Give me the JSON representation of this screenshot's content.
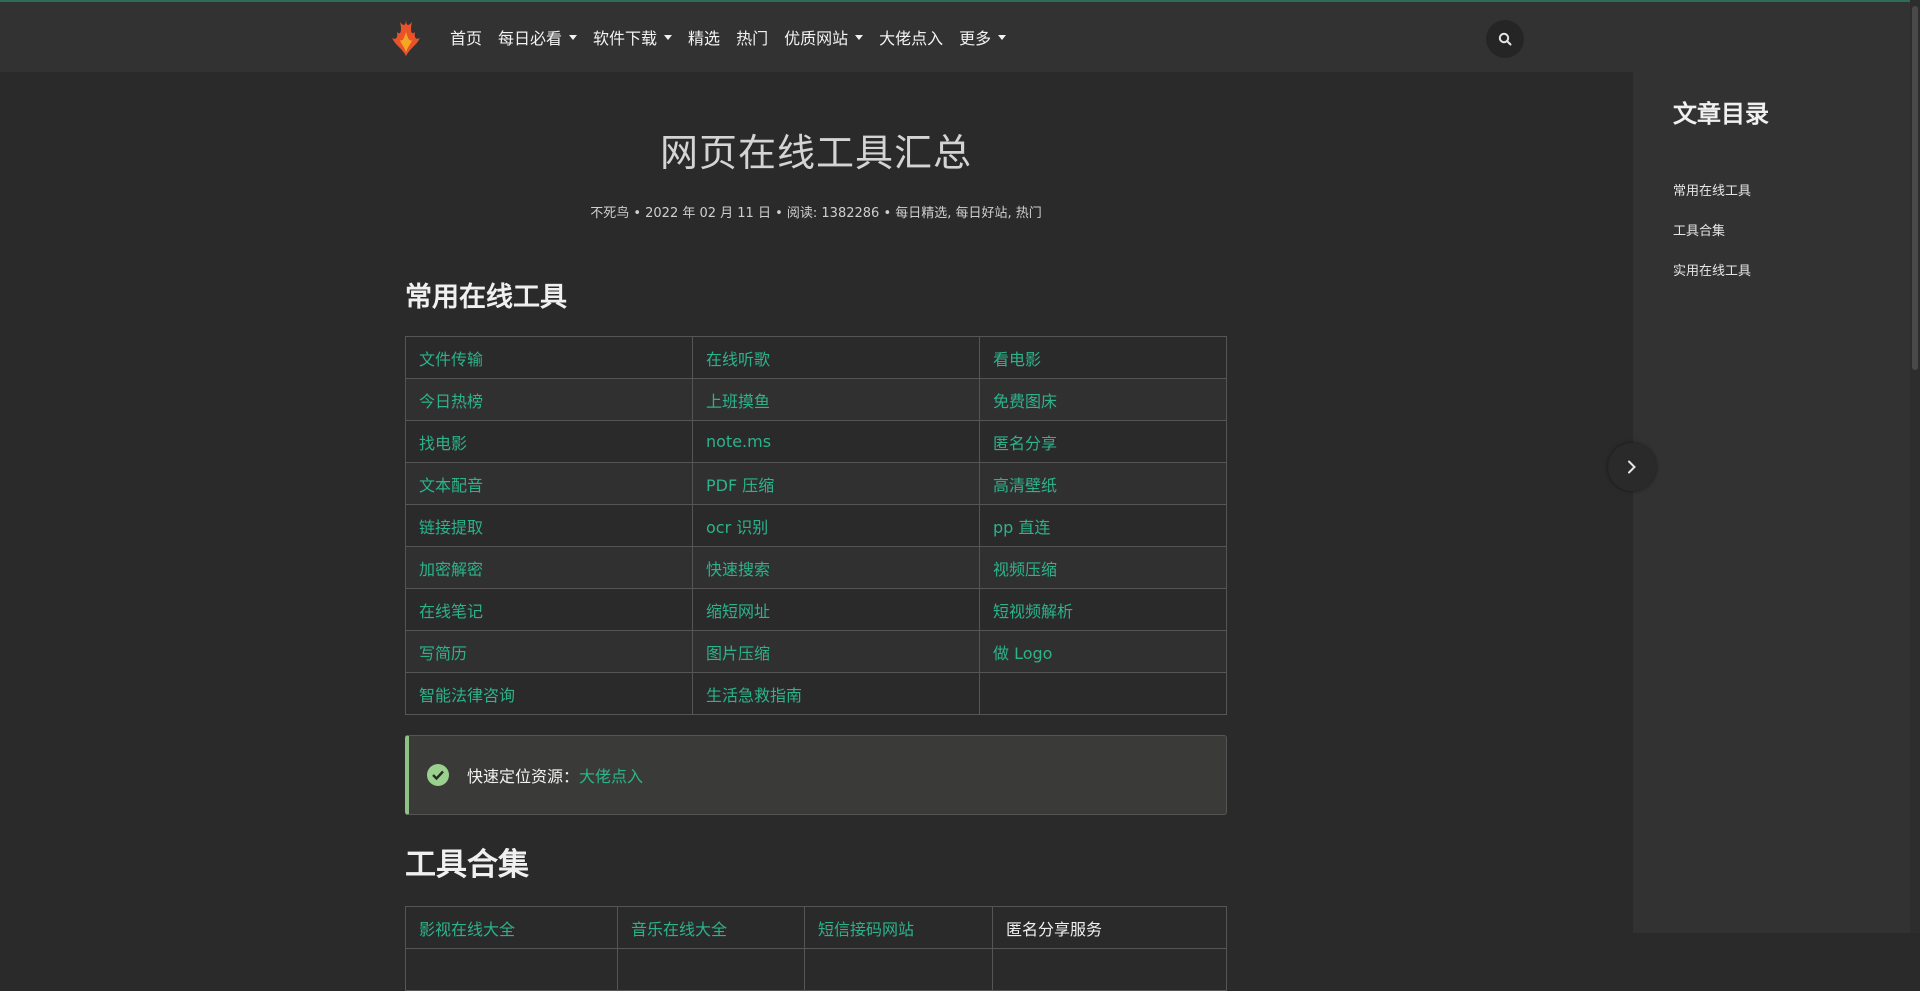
{
  "nav": {
    "logo": "phoenix-logo",
    "items": [
      {
        "label": "首页",
        "dropdown": false
      },
      {
        "label": "每日必看",
        "dropdown": true
      },
      {
        "label": "软件下载",
        "dropdown": true
      },
      {
        "label": "精选",
        "dropdown": false
      },
      {
        "label": "热门",
        "dropdown": false
      },
      {
        "label": "优质网站",
        "dropdown": true
      },
      {
        "label": "大佬点入",
        "dropdown": false
      },
      {
        "label": "更多",
        "dropdown": true
      }
    ],
    "search_icon": "search-icon"
  },
  "article": {
    "title": "网页在线工具汇总",
    "meta": "不死鸟 • 2022 年 02 月 11 日 • 阅读: 1382286 • 每日精选, 每日好站, 热门",
    "section1_heading": "常用在线工具",
    "tools": [
      [
        "文件传输",
        "在线听歌",
        "看电影"
      ],
      [
        "今日热榜",
        "上班摸鱼",
        "免费图床"
      ],
      [
        "找电影",
        "note.ms",
        "匿名分享"
      ],
      [
        "文本配音",
        "PDF 压缩",
        "高清壁纸"
      ],
      [
        "链接提取",
        "ocr 识别",
        "pp 直连"
      ],
      [
        "加密解密",
        "快速搜索",
        "视频压缩"
      ],
      [
        "在线笔记",
        "缩短网址",
        "短视频解析"
      ],
      [
        "写简历",
        "图片压缩",
        "做 Logo"
      ],
      [
        "智能法律咨询",
        "生活急救指南",
        ""
      ]
    ],
    "notice": {
      "label": "快速定位资源：",
      "link": "大佬点入"
    },
    "section2_heading": "工具合集",
    "collection_row": [
      "影视在线大全",
      "音乐在线大全",
      "短信接码网站",
      "匿名分享服务"
    ]
  },
  "toc": {
    "title": "文章目录",
    "items": [
      "常用在线工具",
      "工具合集",
      "实用在线工具"
    ]
  },
  "colors": {
    "link": "#2bb38a",
    "background": "#2b2a2b",
    "notice_accent": "#8ec184"
  }
}
